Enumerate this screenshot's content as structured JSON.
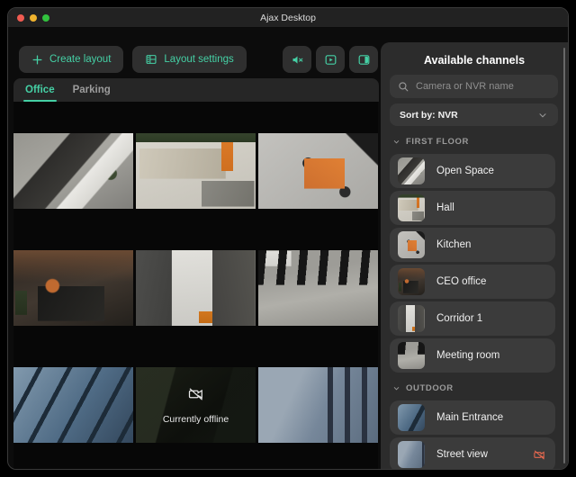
{
  "window": {
    "title": "Ajax Desktop"
  },
  "toolbar": {
    "create_layout_label": "Create layout",
    "layout_settings_label": "Layout settings",
    "icon_buttons": [
      "mute-audio",
      "playback-window",
      "toggle-side-panel"
    ]
  },
  "tabs": [
    {
      "label": "Office",
      "active": true
    },
    {
      "label": "Parking",
      "active": false
    }
  ],
  "grid": {
    "tiles": [
      {
        "scene": "open-space"
      },
      {
        "scene": "hall"
      },
      {
        "scene": "kitchen"
      },
      {
        "scene": "ceo-office"
      },
      {
        "scene": "corridor"
      },
      {
        "scene": "meeting-room"
      },
      {
        "scene": "main-entrance"
      },
      {
        "scene": "offline-camera",
        "status": "Currently offline"
      },
      {
        "scene": "street-view"
      }
    ]
  },
  "sidebar": {
    "title": "Available channels",
    "search_placeholder": "Camera or NVR name",
    "sort_label": "Sort by: NVR",
    "sections": [
      {
        "label": "FIRST FLOOR",
        "items": [
          {
            "label": "Open Space"
          },
          {
            "label": "Hall"
          },
          {
            "label": "Kitchen"
          },
          {
            "label": "CEO office"
          },
          {
            "label": "Corridor 1"
          },
          {
            "label": "Meeting room"
          }
        ]
      },
      {
        "label": "OUTDOOR",
        "items": [
          {
            "label": "Main Entrance"
          },
          {
            "label": "Street view",
            "offline": true
          }
        ]
      }
    ]
  },
  "colors": {
    "accent": "#45d0a5",
    "offline_red": "#e5684f",
    "traffic_red": "#f05b51",
    "traffic_yellow": "#f0b32e",
    "traffic_green": "#32c23e"
  }
}
